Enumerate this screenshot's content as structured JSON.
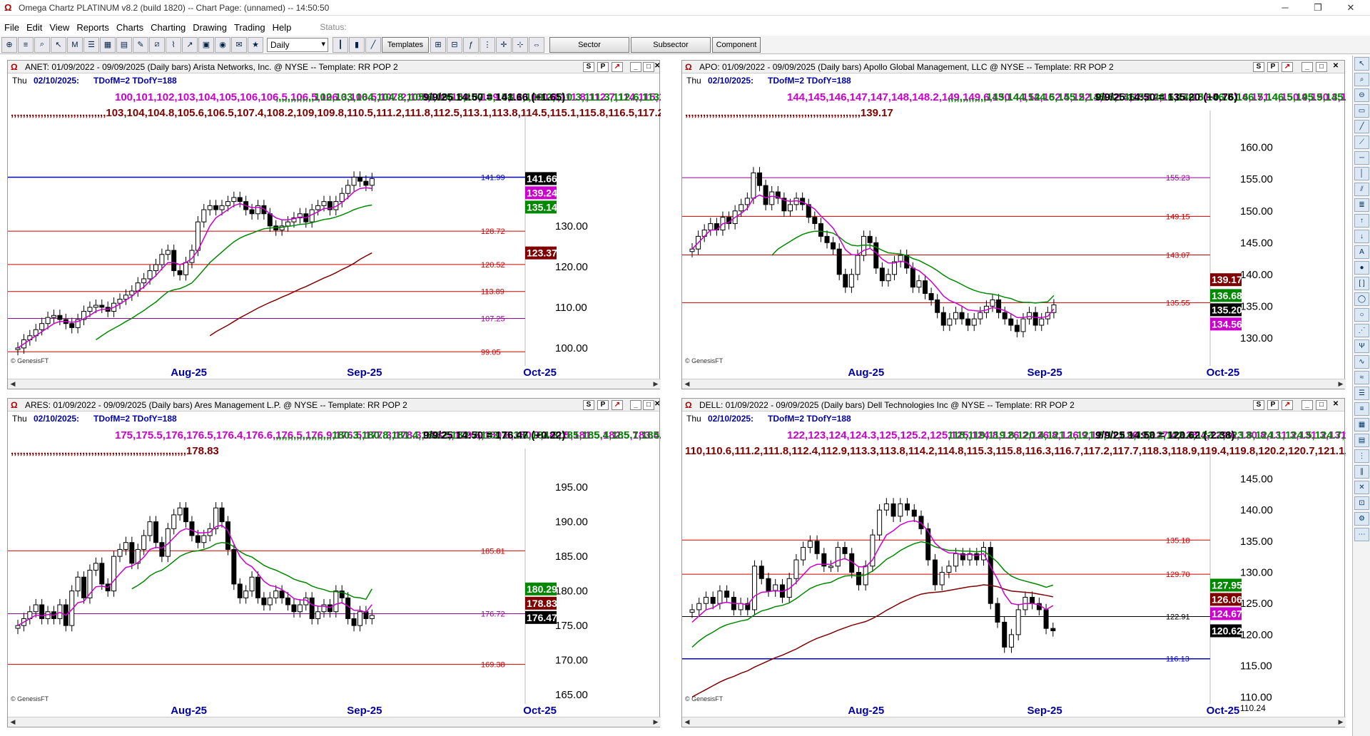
{
  "window": {
    "title": "Omega Chartz PLATINUM v8.2 (build 1820)  --  Chart Page: (unnamed)  --  14:50:50"
  },
  "menu": [
    "File",
    "Edit",
    "View",
    "Reports",
    "Charts",
    "Charting",
    "Drawing",
    "Trading",
    "Help"
  ],
  "status_label": "Status:",
  "toolbar": {
    "period": "Daily",
    "templates": "Templates",
    "sector": "Sector",
    "subsector": "Subsector",
    "component": "Component"
  },
  "colors": {
    "ema8": "#cc00cc",
    "ema21": "#008800",
    "ema55": "#800000",
    "blue_line": "#0000cc",
    "red_line": "#cc0000",
    "purple_line": "#990099"
  },
  "common": {
    "day_line": "Thu",
    "date_line": "02/10/2025:",
    "td_line": "TDofM=2  TDofY=188",
    "copyright": "© GenesisFT",
    "months": [
      "Aug-25",
      "Sep-25",
      "Oct-25"
    ]
  },
  "panels": [
    {
      "id": "anet",
      "header": "ANET: 01/09/2022 - 09/09/2025  (Daily bars)  Arista Networks, Inc. @ NYSE  --  Template: RR POP 2",
      "ema8": [
        100,
        101,
        102,
        103,
        104,
        105,
        106,
        106.5,
        106.5,
        106.3,
        106.5,
        107.2,
        108,
        109,
        109.5,
        109.5,
        110,
        110.8,
        111.8,
        112.7,
        114,
        115,
        116.5,
        117.8,
        119.5,
        121,
        121,
        120.5,
        121,
        122,
        124,
        127,
        130,
        132,
        133,
        134,
        135,
        135.5,
        135,
        134.5,
        134.6,
        134.2,
        133,
        132,
        131.5,
        131.5,
        131.8,
        132.2,
        132,
        132.8,
        133.5,
        134.3,
        134.3,
        134.8,
        135.8,
        137,
        138.4,
        139.2,
        139.4,
        139.24
      ],
      "ema21": [
        null,
        null,
        null,
        null,
        null,
        null,
        null,
        null,
        null,
        null,
        null,
        null,
        null,
        102,
        103,
        104,
        104.8,
        105.6,
        106.5,
        107.3,
        108.3,
        109.2,
        110.3,
        111.3,
        112.6,
        113.8,
        114.3,
        114.6,
        115.2,
        116,
        117.6,
        119.3,
        121,
        122.3,
        123.6,
        124.9,
        126.1,
        127,
        127.7,
        128.2,
        128.8,
        129.3,
        129.5,
        129.6,
        129.7,
        129.9,
        130.1,
        130.4,
        130.5,
        130.8,
        131.2,
        131.6,
        131.8,
        132.2,
        132.7,
        133.3,
        134,
        134.5,
        134.9,
        135.14
      ],
      "last": "9/9/25 14:50 = 141.66 (+1.65)",
      "ema55": [
        null,
        null,
        null,
        null,
        null,
        null,
        null,
        null,
        null,
        null,
        null,
        null,
        null,
        null,
        null,
        null,
        null,
        null,
        null,
        null,
        null,
        null,
        null,
        null,
        null,
        null,
        null,
        null,
        null,
        null,
        null,
        null,
        103,
        104,
        104.8,
        105.6,
        106.5,
        107.4,
        108.2,
        109,
        109.8,
        110.5,
        111.2,
        111.8,
        112.5,
        113.1,
        113.8,
        114.5,
        115.1,
        115.8,
        116.5,
        117.2,
        117.8,
        118.5,
        119.3,
        120,
        120.8,
        121.8,
        122.6,
        123.37
      ],
      "ymin": 97,
      "ymax": 154,
      "yticks": [
        100,
        110,
        120,
        130
      ],
      "levels": [
        {
          "v": 141.99,
          "label": "141.99",
          "color": "#0000cc",
          "w": 1.5
        },
        {
          "v": 128.72,
          "label": "128.72",
          "color": "#cc0000",
          "w": 1
        },
        {
          "v": 120.52,
          "label": "120.52",
          "color": "#cc0000",
          "w": 1
        },
        {
          "v": 113.89,
          "label": "113.89",
          "color": "#cc0000",
          "w": 1
        },
        {
          "v": 107.25,
          "label": "107.25",
          "color": "#990099",
          "w": 1
        },
        {
          "v": 99.05,
          "label": "99.05",
          "color": "#cc0000",
          "w": 1
        }
      ],
      "tags": [
        {
          "v": 141.66,
          "label": "141.66",
          "bg": "#000",
          "fg": "#fff"
        },
        {
          "v": 139.24,
          "label": "139.24",
          "bg": "#cc00cc",
          "fg": "#fff"
        },
        {
          "v": 135.14,
          "label": "135.14",
          "bg": "#008800",
          "fg": "#fff"
        },
        {
          "v": 123.37,
          "label": "123.37",
          "bg": "#800000",
          "fg": "#fff"
        }
      ],
      "closes": [
        100,
        102,
        103,
        104.5,
        106,
        107.5,
        108,
        107,
        106,
        105,
        107,
        109,
        110,
        110.5,
        110,
        109,
        111,
        112,
        113,
        114,
        116,
        117,
        119,
        120.5,
        123,
        124,
        119,
        118,
        121,
        124,
        131,
        134,
        135,
        134,
        135,
        136,
        137,
        136,
        134,
        133,
        135,
        133,
        130,
        129,
        130,
        131,
        132,
        133,
        131,
        134,
        135,
        136,
        134,
        136,
        138,
        140,
        142,
        141,
        140,
        141.66
      ]
    },
    {
      "id": "apo",
      "header": "APO: 01/09/2022 - 09/09/2025  (Daily bars)  Apollo Global Management, LLC @ NYSE  --  Template: RR POP 2",
      "ema8": [
        144,
        145,
        146,
        147,
        147,
        148,
        148.2,
        149,
        149.6,
        150.4,
        152,
        152.5,
        152.1,
        152.3,
        152.2,
        151.7,
        151.5,
        151.6,
        151.4,
        150.9,
        150.3,
        149.2,
        148.3,
        147.3,
        145.7,
        143.9,
        143.1,
        143.1,
        143.8,
        144.1,
        143.4,
        142.4,
        141.8,
        141.8,
        142.1,
        141.9,
        141,
        140.6,
        139.8,
        138.9,
        137.8,
        136.6,
        135.9,
        135.5,
        135,
        134.4,
        134.3,
        134.2,
        134.4,
        134.8,
        134.6,
        134.3,
        133.8,
        133.2,
        133.2,
        133.4,
        133.2,
        133.2,
        133.4,
        134.56
      ],
      "ema21": [
        null,
        null,
        null,
        null,
        null,
        null,
        null,
        null,
        null,
        null,
        null,
        null,
        null,
        143,
        144,
        144.6,
        145.2,
        145.8,
        146.3,
        146.6,
        146.8,
        146.8,
        146.7,
        146.5,
        145.9,
        145.1,
        144.6,
        144.5,
        144.6,
        144.6,
        144.3,
        143.8,
        143.4,
        143.3,
        143.2,
        143,
        142.5,
        142.2,
        141.7,
        141.2,
        140.6,
        139.9,
        139.3,
        138.9,
        138.4,
        137.9,
        137.5,
        137.2,
        137,
        136.9,
        136.7,
        136.4,
        136.2,
        135.8,
        135.6,
        135.6,
        135.5,
        135.6,
        135.7,
        136.68
      ],
      "last": "9/9/25 14:50 = 135.20 (+0.76)",
      "ema55": [
        null,
        null,
        null,
        null,
        null,
        null,
        null,
        null,
        null,
        null,
        null,
        null,
        null,
        null,
        null,
        null,
        null,
        null,
        null,
        null,
        null,
        null,
        null,
        null,
        null,
        null,
        null,
        null,
        null,
        null,
        null,
        null,
        null,
        null,
        null,
        null,
        null,
        null,
        null,
        null,
        null,
        null,
        null,
        null,
        null,
        null,
        null,
        null,
        null,
        null,
        null,
        null,
        null,
        null,
        null,
        null,
        null,
        null,
        null,
        139.17
      ],
      "ymin": 126.5,
      "ymax": 163,
      "yticks": [
        130,
        135,
        140,
        145,
        150,
        155,
        160
      ],
      "levels": [
        {
          "v": 155.23,
          "label": "155.23",
          "color": "#990099",
          "w": 1
        },
        {
          "v": 149.15,
          "label": "149.15",
          "color": "#cc0000",
          "w": 1
        },
        {
          "v": 143.07,
          "label": "143.07",
          "color": "#cc0000",
          "w": 1
        },
        {
          "v": 135.55,
          "label": "135.55",
          "color": "#cc0000",
          "w": 1
        }
      ],
      "tags": [
        {
          "v": 139.17,
          "label": "139.17",
          "bg": "#800000",
          "fg": "#fff"
        },
        {
          "v": 136.68,
          "label": "136.68",
          "bg": "#008800",
          "fg": "#fff"
        },
        {
          "v": 135.2,
          "label": "135.20",
          "bg": "#000",
          "fg": "#fff"
        },
        {
          "v": 134.56,
          "label": "134.56",
          "bg": "#cc00cc",
          "fg": "#fff"
        }
      ],
      "closes": [
        144,
        146,
        147,
        148,
        147,
        149,
        148,
        150,
        151,
        152,
        156,
        154,
        151,
        153,
        152,
        150,
        151,
        152,
        151,
        149,
        148,
        146,
        145,
        144,
        140,
        138,
        140,
        143,
        146,
        145,
        141,
        139,
        140,
        142,
        143,
        141,
        138,
        139,
        137,
        136,
        134,
        132,
        133,
        134,
        133,
        132,
        133,
        134,
        135,
        136,
        134,
        133,
        132,
        131,
        133,
        134,
        132,
        133,
        134,
        135.2
      ]
    },
    {
      "id": "ares",
      "header": "ARES: 01/09/2022 - 09/09/2025  (Daily bars)  Ares Management L.P. @ NYSE  --  Template: RR POP 2",
      "ema8": [
        175,
        175.5,
        176,
        176.5,
        176.4,
        176.6,
        176.5,
        176.9,
        176.5,
        177.3,
        178.3,
        178.5,
        179.6,
        180.6,
        180.7,
        180.5,
        181.5,
        182.5,
        183.4,
        183.6,
        184.1,
        184.9,
        186,
        186.3,
        186.2,
        186.8,
        187.7,
        188.6,
        189,
        188.8,
        188.4,
        188.4,
        188.5,
        189.3,
        189.5,
        188.7,
        186.8,
        185,
        184,
        183.5,
        182.5,
        181.4,
        180.8,
        180.6,
        180.2,
        179.6,
        178.9,
        178.7,
        178.7,
        178,
        177.8,
        177.8,
        177.6,
        178.1,
        178.3,
        177.8,
        177.2,
        177.2,
        176.9,
        178.03
      ],
      "ema21": [
        null,
        null,
        null,
        null,
        null,
        null,
        null,
        null,
        null,
        null,
        null,
        null,
        null,
        null,
        null,
        null,
        null,
        null,
        null,
        180.3,
        180.8,
        181.4,
        182.2,
        182.7,
        183,
        183.6,
        184.3,
        185,
        185.4,
        185.7,
        185.8,
        186,
        186.3,
        186.8,
        187,
        186.9,
        186.4,
        185.7,
        185.2,
        184.9,
        184.3,
        183.7,
        183.3,
        183,
        182.6,
        182.2,
        181.7,
        181.4,
        181.2,
        180.7,
        180.4,
        180.2,
        179.9,
        179.9,
        179.8,
        179.5,
        179.1,
        179,
        178.8,
        180.29
      ],
      "last": "9/9/25 14:50 = 176.47 (+0.22)",
      "ema55": [
        null,
        null,
        null,
        null,
        null,
        null,
        null,
        null,
        null,
        null,
        null,
        null,
        null,
        null,
        null,
        null,
        null,
        null,
        null,
        null,
        null,
        null,
        null,
        null,
        null,
        null,
        null,
        null,
        null,
        null,
        null,
        null,
        null,
        null,
        null,
        null,
        null,
        null,
        null,
        null,
        null,
        null,
        null,
        null,
        null,
        null,
        null,
        null,
        null,
        null,
        null,
        null,
        null,
        null,
        null,
        null,
        null,
        null,
        null,
        178.83
      ],
      "ymin": 164.5,
      "ymax": 198,
      "yticks": [
        165,
        170,
        175,
        180,
        185,
        190,
        195
      ],
      "levels": [
        {
          "v": 185.81,
          "label": "185.81",
          "color": "#cc0000",
          "w": 1
        },
        {
          "v": 176.72,
          "label": "176.72",
          "color": "#990099",
          "w": 1
        },
        {
          "v": 169.38,
          "label": "169.38",
          "color": "#cc0000",
          "w": 1
        }
      ],
      "tags": [
        {
          "v": 180.29,
          "label": "180.29",
          "bg": "#008800",
          "fg": "#fff"
        },
        {
          "v": 178.83,
          "label": "178.83",
          "bg": "#800000",
          "fg": "#fff"
        },
        {
          "v": 176.47,
          "label": "176.47",
          "bg": "#000",
          "fg": "#fff"
        }
      ],
      "closes": [
        175,
        176,
        177,
        178,
        176,
        177,
        176,
        178,
        175,
        180,
        182,
        179,
        183,
        184,
        181,
        180,
        185,
        186,
        187,
        184,
        186,
        188,
        190,
        187,
        185,
        189,
        191,
        192,
        190,
        188,
        187,
        188,
        189,
        192,
        190,
        186,
        181,
        179,
        180,
        182,
        179,
        178,
        179,
        180,
        179,
        178,
        177,
        178,
        179,
        176,
        177,
        178,
        177,
        180,
        179,
        176,
        175,
        177,
        176,
        176.47
      ]
    },
    {
      "id": "dell",
      "header": "DELL: 01/09/2022 - 09/09/2025  (Daily bars)  Dell Technologies Inc @ NYSE  --  Template: RR POP 2",
      "ema8": [
        122,
        123,
        124,
        124.3,
        125,
        125.2,
        125,
        125,
        124.8,
        126.2,
        126.8,
        126.9,
        127.1,
        126.9,
        127.4,
        128.4,
        129.6,
        130.8,
        131.3,
        131.3,
        131.3,
        131.9,
        132.2,
        131.7,
        130.9,
        130.9,
        132,
        134.1,
        136,
        136.7,
        137.6,
        138.1,
        138.3,
        137.9,
        136.6,
        134.7,
        133.7,
        133.1,
        133.1,
        132.8,
        132.9,
        132.7,
        133,
        130.9,
        128.9,
        126.5,
        125,
        124.8,
        125,
        125,
        124.8,
        124.0,
        124.67
      ],
      "ema21": [
        118,
        119,
        119.8,
        120.4,
        121.1,
        121.6,
        121.9,
        122.2,
        122.4,
        123.2,
        123.8,
        124.1,
        124.5,
        124.7,
        125.1,
        125.8,
        126.6,
        127.4,
        127.9,
        128.2,
        128.4,
        129,
        129.4,
        129.5,
        129.4,
        129.6,
        130.2,
        131.1,
        132.1,
        132.7,
        133.5,
        134.1,
        134.6,
        134.9,
        134.7,
        134.1,
        133.8,
        133.5,
        133.5,
        133.4,
        133.4,
        133.3,
        133.4,
        132.6,
        131.6,
        130.3,
        129.4,
        128.9,
        128.6,
        128.3,
        128,
        127.6,
        127.95
      ],
      "last": "9/9/25 14:50 = 120.62 (-2.38)",
      "ema55": [
        110,
        110.6,
        111.2,
        111.8,
        112.4,
        112.9,
        113.3,
        113.8,
        114.2,
        114.8,
        115.3,
        115.8,
        116.3,
        116.7,
        117.2,
        117.7,
        118.3,
        118.9,
        119.4,
        119.8,
        120.2,
        120.7,
        121.1,
        121.5,
        121.8,
        122.1,
        122.6,
        123.2,
        123.9,
        124.5,
        125.1,
        125.6,
        126.1,
        126.5,
        126.7,
        126.8,
        126.9,
        127.1,
        127.3,
        127.5,
        127.7,
        127.8,
        128,
        127.9,
        127.7,
        127.3,
        127,
        126.9,
        126.8,
        126.7,
        126.5,
        126.3,
        126.06
      ],
      "ymin": 109.8,
      "ymax": 147,
      "yticks": [
        110,
        115,
        120,
        125,
        130,
        135,
        140,
        145
      ],
      "extra_label": "110.24",
      "levels": [
        {
          "v": 135.18,
          "label": "135.18",
          "color": "#cc0000",
          "w": 1
        },
        {
          "v": 129.7,
          "label": "129.70",
          "color": "#cc0000",
          "w": 1
        },
        {
          "v": 122.91,
          "label": "122.91",
          "color": "#000000",
          "w": 1
        },
        {
          "v": 116.13,
          "label": "116.13",
          "color": "#0000cc",
          "w": 1.5
        }
      ],
      "tags": [
        {
          "v": 127.95,
          "label": "127.95",
          "bg": "#008800",
          "fg": "#fff"
        },
        {
          "v": 126.06,
          "label": "126.06",
          "bg": "#800000",
          "fg": "#fff"
        },
        {
          "v": 124.67,
          "label": "124.67",
          "bg": "#cc00cc",
          "fg": "#fff"
        },
        {
          "v": 120.62,
          "label": "120.62",
          "bg": "#000",
          "fg": "#fff"
        }
      ],
      "closes": [
        124,
        125,
        126,
        125,
        127,
        126,
        124,
        125,
        124,
        131,
        129,
        127,
        128,
        126,
        129,
        132,
        134,
        135,
        133,
        131,
        131,
        134,
        133,
        130,
        128,
        131,
        136,
        140,
        141,
        139,
        141,
        140,
        139,
        137,
        132,
        128,
        130,
        131,
        133,
        132,
        133,
        132,
        134,
        125,
        122,
        118,
        120,
        124,
        126,
        125,
        124,
        121,
        120.62
      ]
    }
  ]
}
